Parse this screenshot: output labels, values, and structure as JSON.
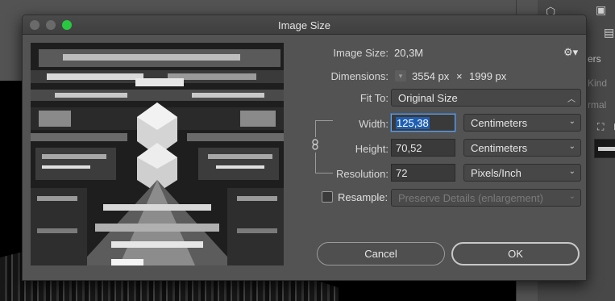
{
  "dialog": {
    "title": "Image Size"
  },
  "info": {
    "image_size_label": "Image Size:",
    "image_size_value": "20,3M",
    "dimensions_label": "Dimensions:",
    "dimensions_width": "3554 px",
    "dimensions_x": "×",
    "dimensions_height": "1999 px"
  },
  "fit_to": {
    "label": "Fit To:",
    "value": "Original Size"
  },
  "width": {
    "label": "Width:",
    "value": "125,38",
    "unit": "Centimeters"
  },
  "height": {
    "label": "Height:",
    "value": "70,52",
    "unit": "Centimeters"
  },
  "resolution": {
    "label": "Resolution:",
    "value": "72",
    "unit": "Pixels/Inch"
  },
  "resample": {
    "label": "Resample:",
    "checked": false,
    "method": "Preserve Details (enlargement)"
  },
  "buttons": {
    "cancel": "Cancel",
    "ok": "OK"
  },
  "workspace": {
    "panel_label_1": "ers",
    "panel_label_2": "Kind",
    "panel_label_3": "rmal"
  },
  "icons": {
    "settings": "gear-icon",
    "link": "chain-link-icon",
    "dropdown": "chevron-down-icon"
  },
  "colors": {
    "focus_ring": "#6f9fd8",
    "text_selection": "#1f5fb2",
    "maximize_button": "#28c840"
  }
}
